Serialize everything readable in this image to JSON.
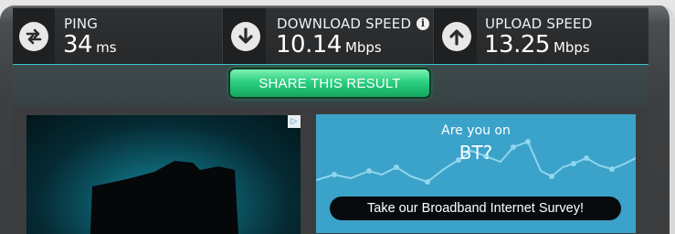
{
  "stats": {
    "ping": {
      "label": "PING",
      "value": "34",
      "unit": "ms"
    },
    "download": {
      "label": "DOWNLOAD SPEED",
      "value": "10.14",
      "unit": "Mbps"
    },
    "upload": {
      "label": "UPLOAD SPEED",
      "value": "13.25",
      "unit": "Mbps"
    },
    "info_glyph": "i"
  },
  "share_button": {
    "label": "SHARE THIS RESULT"
  },
  "ads": {
    "ad_choices_glyph": "▷",
    "survey": {
      "question_line1": "Are you on",
      "question_line2": "BT?",
      "cta": "Take our Broadband Internet Survey!"
    }
  },
  "colors": {
    "accent_teal": "#39c6c8",
    "share_green": "#2bd07f",
    "ad_blue": "#3ba2c9"
  },
  "icons": [
    "swap-arrows-icon",
    "download-arrow-icon",
    "upload-arrow-icon",
    "info-icon",
    "ad-choices-icon"
  ]
}
